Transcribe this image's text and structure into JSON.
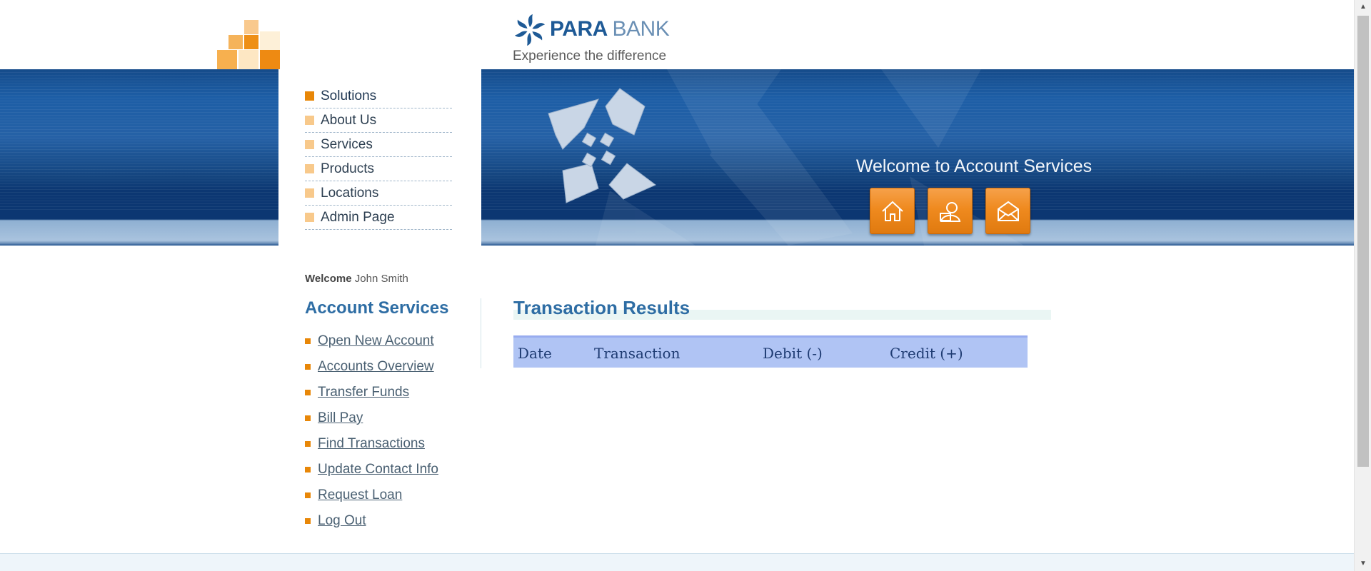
{
  "brand": {
    "name_bold": "PARA",
    "name_light": "BANK",
    "tagline": "Experience the difference"
  },
  "solutions_menu": [
    {
      "label": "Solutions",
      "active": true
    },
    {
      "label": "About Us"
    },
    {
      "label": "Services"
    },
    {
      "label": "Products"
    },
    {
      "label": "Locations"
    },
    {
      "label": "Admin Page"
    }
  ],
  "hero": {
    "welcome": "Welcome to Account Services",
    "icons": [
      "home-icon",
      "contact-icon",
      "mail-icon"
    ]
  },
  "user": {
    "welcome_label": "Welcome",
    "name": "John Smith"
  },
  "account_services": {
    "title": "Account Services",
    "links": [
      "Open New Account",
      "Accounts Overview",
      "Transfer Funds",
      "Bill Pay",
      "Find Transactions",
      "Update Contact Info",
      "Request Loan",
      "Log Out"
    ]
  },
  "results": {
    "title": "Transaction Results",
    "columns": [
      "Date",
      "Transaction",
      "Debit (-)",
      "Credit (+)"
    ]
  },
  "colors": {
    "accent_orange": "#e88708",
    "brand_blue": "#2e6da4",
    "band_blue": "#1d5ea6",
    "table_header": "#b0c4f4"
  }
}
